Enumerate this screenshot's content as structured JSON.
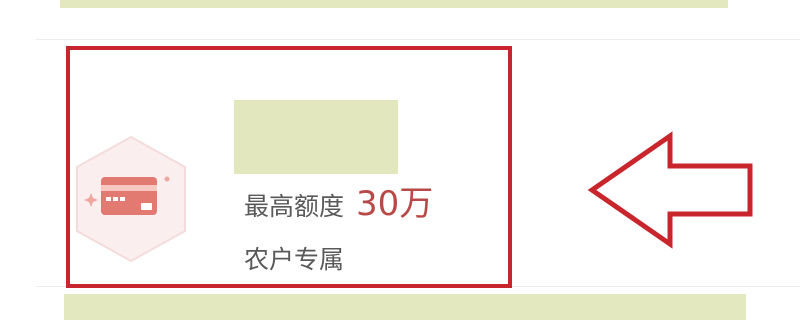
{
  "product": {
    "limit_label": "最高额度",
    "limit_value": "30万",
    "tag": "农户专属",
    "icon": "credit-card-icon"
  },
  "colors": {
    "accent": "#b74a48",
    "annotation": "#c8262c",
    "mask": "#e4e8be"
  }
}
